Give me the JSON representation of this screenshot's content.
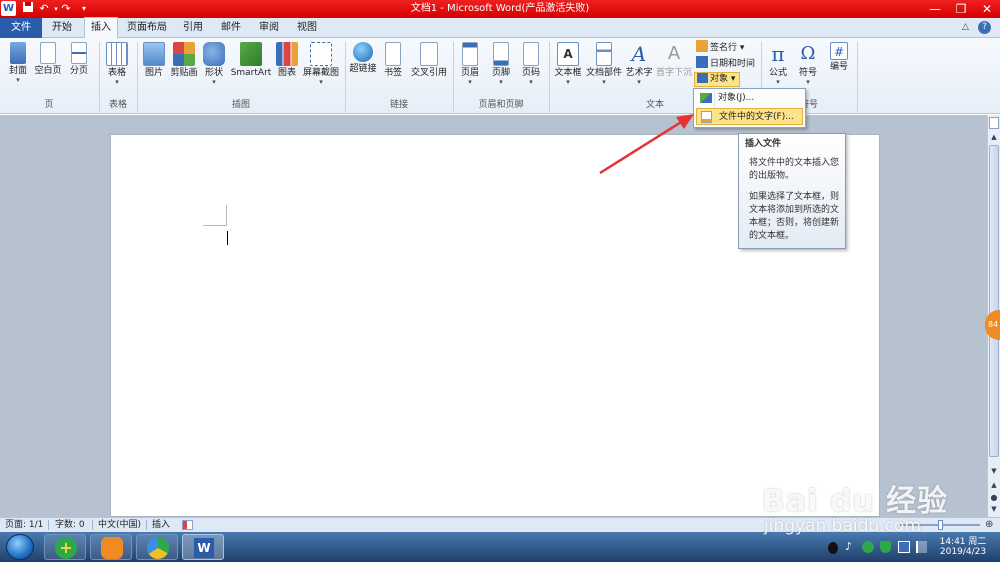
{
  "window": {
    "title": "文档1 - Microsoft Word(产品激活失败)",
    "app_icon": "W",
    "quick_access": [
      "save-icon",
      "undo-icon",
      "redo-icon",
      "customize-icon"
    ],
    "controls": {
      "minimize": "—",
      "restore": "❐",
      "close": "✕"
    }
  },
  "tabs": {
    "file": "文件",
    "items": [
      "开始",
      "插入",
      "页面布局",
      "引用",
      "邮件",
      "审阅",
      "视图"
    ],
    "active": "插入"
  },
  "ribbon": {
    "groups": {
      "pages": {
        "label": "页",
        "buttons": [
          "封面",
          "空白页",
          "分页"
        ]
      },
      "tables": {
        "label": "表格",
        "buttons": [
          "表格"
        ]
      },
      "illustrations": {
        "label": "插图",
        "buttons": [
          "图片",
          "剪贴画",
          "形状",
          "SmartArt",
          "图表",
          "屏幕截图"
        ]
      },
      "links": {
        "label": "链接",
        "buttons": [
          "超链接",
          "书签",
          "交叉引用"
        ]
      },
      "header_footer": {
        "label": "页眉和页脚",
        "buttons": [
          "页眉",
          "页脚",
          "页码"
        ]
      },
      "text": {
        "label": "文本",
        "buttons": [
          "文本框",
          "文档部件",
          "艺术字",
          "首字下沉"
        ],
        "small": [
          "签名行",
          "日期和时间",
          "对象"
        ]
      },
      "symbols": {
        "label": "符号",
        "buttons": [
          "公式",
          "符号",
          "编号"
        ],
        "glyphs": [
          "π",
          "Ω",
          "#"
        ]
      }
    }
  },
  "dropdown": {
    "items": [
      "对象(J)...",
      "文件中的文字(F)..."
    ]
  },
  "tooltip": {
    "title": "插入文件",
    "p1": "将文件中的文本插入您的出版物。",
    "p2": "如果选择了文本框，则文本将添加到所选的文本框；否则，将创建新的文本框。"
  },
  "status": {
    "page": "页面: 1/1",
    "words": "字数: 0",
    "language": "中文(中国)",
    "mode": "插入"
  },
  "taskbar": {
    "time": "14:41 周二",
    "date": "2019/4/23",
    "side_badge": "84"
  },
  "watermark": {
    "brand": "Bai du 经验",
    "url": "jingyan.baidu.com"
  },
  "colors": {
    "title_bar": "#e00000",
    "file_tab": "#2a5caa",
    "highlight": "#fde38a",
    "arrow": "#e53333"
  }
}
